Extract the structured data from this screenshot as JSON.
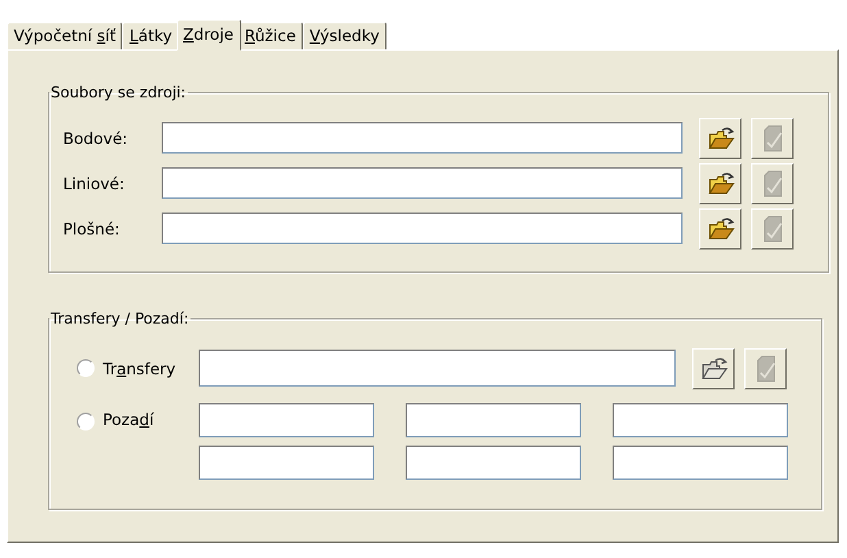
{
  "tabs": [
    {
      "label": {
        "before": "Výpočetní ",
        "key": "s",
        "after": "íť"
      },
      "selected": false
    },
    {
      "label": {
        "key": "L",
        "after": "átky"
      },
      "selected": false
    },
    {
      "label": {
        "key": "Z",
        "after": "droje"
      },
      "selected": true
    },
    {
      "label": {
        "key": "R",
        "after": "ůžice"
      },
      "selected": false
    },
    {
      "label": {
        "key": "V",
        "after": "ýsledky"
      },
      "selected": false
    }
  ],
  "source_files": {
    "title": "Soubory se zdroji:",
    "rows": [
      {
        "label": "Bodové:",
        "open_disabled": false,
        "confirm_disabled": true
      },
      {
        "label": "Liniové:",
        "open_disabled": false,
        "confirm_disabled": true
      },
      {
        "label": "Plošné:",
        "open_disabled": false,
        "confirm_disabled": true
      }
    ]
  },
  "transfers": {
    "title": "Transfery / Pozadí:",
    "transfer_option": {
      "label": {
        "before": "Tr",
        "key": "a",
        "after": "nsfery"
      },
      "selected": false,
      "open_disabled": true,
      "confirm_disabled": true
    },
    "background_option": {
      "label": {
        "before": "Poza",
        "key": "d",
        "after": "í"
      },
      "selected": false
    }
  }
}
